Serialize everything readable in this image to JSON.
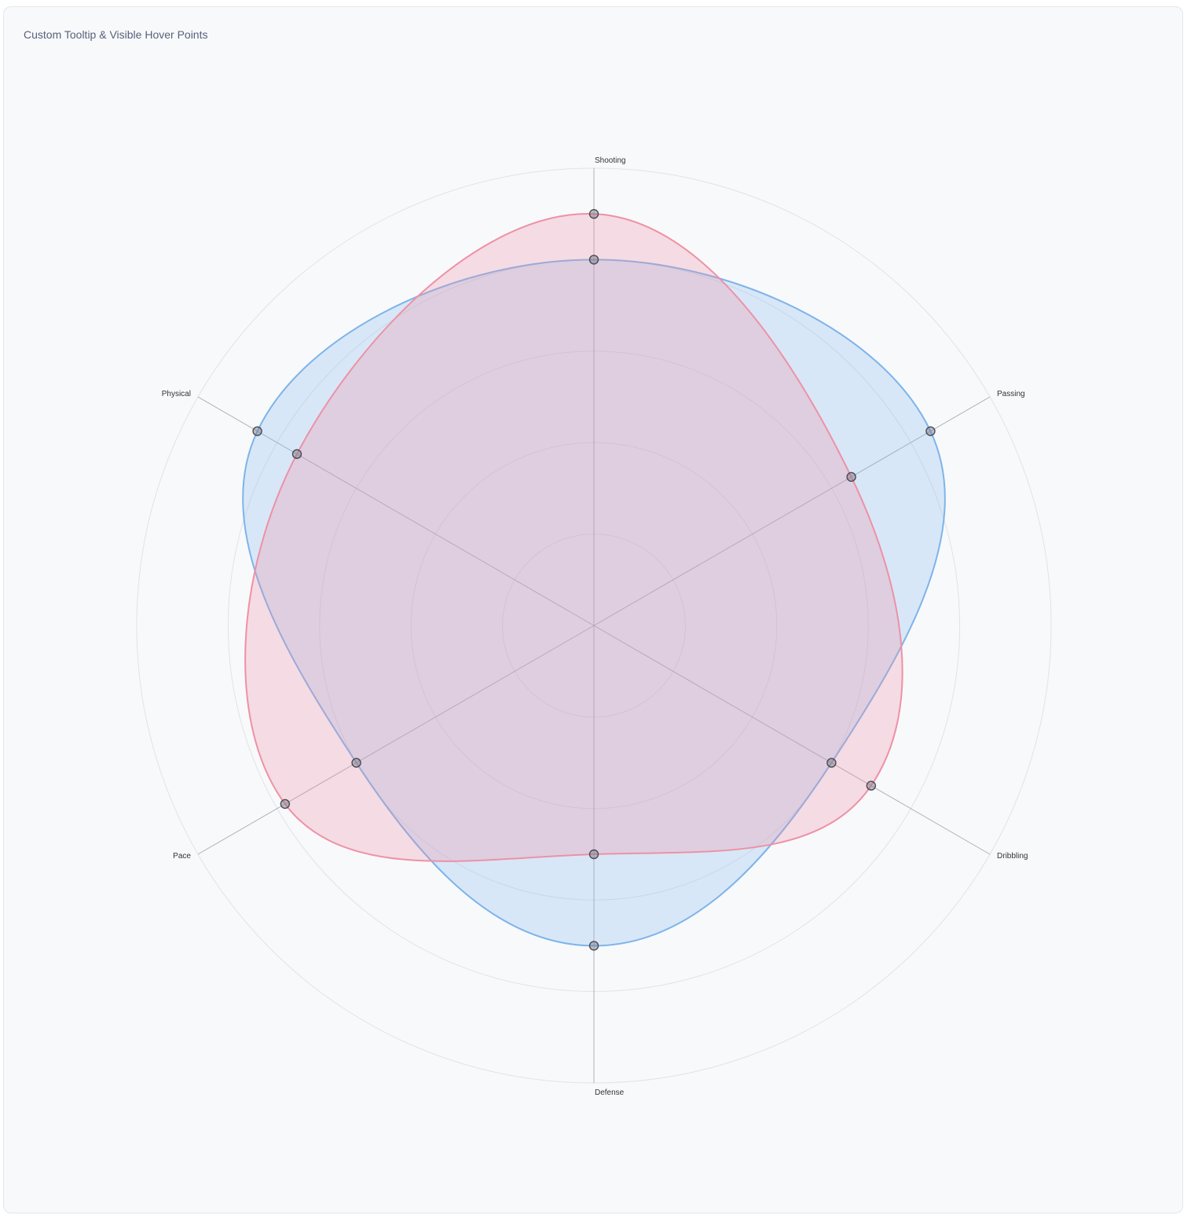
{
  "title": "Custom Tooltip & Visible Hover Points",
  "colors": {
    "series_blue": "#7db4ea",
    "series_blue_fill": "rgba(125,180,234,0.26)",
    "series_red": "#ee91a5",
    "series_red_fill": "rgba(238,145,165,0.28)",
    "grid": "#e2e3e8",
    "axis_line": "#9a9aa2",
    "point_fill": "rgba(120,120,130,0.45)",
    "point_stroke": "#4a4a52"
  },
  "chart_data": {
    "type": "radar",
    "categories": [
      "Shooting",
      "Passing",
      "Dribbling",
      "Defense",
      "Pace",
      "Physical"
    ],
    "rmax": 5,
    "ring_count": 5,
    "grid": true,
    "curve": "smooth",
    "legend": "none",
    "series": [
      {
        "values": [
          4.0,
          4.25,
          3.0,
          3.5,
          3.0,
          4.25
        ]
      },
      {
        "values": [
          4.5,
          3.25,
          3.5,
          2.5,
          3.9,
          3.75
        ]
      }
    ]
  }
}
